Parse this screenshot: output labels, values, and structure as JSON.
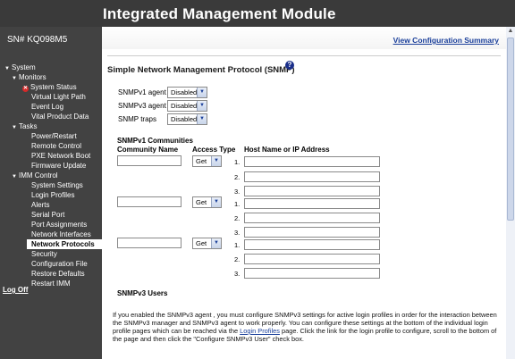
{
  "header": {
    "title": "Integrated Management Module"
  },
  "sidebar": {
    "serial": "SN# KQ098M5",
    "items": [
      {
        "label": "System"
      },
      {
        "label": "Monitors"
      },
      {
        "label": "System Status"
      },
      {
        "label": "Virtual Light Path"
      },
      {
        "label": "Event Log"
      },
      {
        "label": "Vital Product Data"
      },
      {
        "label": "Tasks"
      },
      {
        "label": "Power/Restart"
      },
      {
        "label": "Remote Control"
      },
      {
        "label": "PXE Network Boot"
      },
      {
        "label": "Firmware Update"
      },
      {
        "label": "IMM Control"
      },
      {
        "label": "System Settings"
      },
      {
        "label": "Login Profiles"
      },
      {
        "label": "Alerts"
      },
      {
        "label": "Serial Port"
      },
      {
        "label": "Port Assignments"
      },
      {
        "label": "Network Interfaces"
      },
      {
        "label": "Network Protocols"
      },
      {
        "label": "Security"
      },
      {
        "label": "Configuration File"
      },
      {
        "label": "Restore Defaults"
      },
      {
        "label": "Restart IMM"
      }
    ],
    "logoff": "Log Off"
  },
  "content": {
    "view_config_link": "View Configuration Summary",
    "section_title": "Simple Network Management Protocol (SNMP)",
    "help_icon": "?",
    "agents": [
      {
        "label": "SNMPv1 agent",
        "value": "Disabled"
      },
      {
        "label": "SNMPv3 agent",
        "value": "Disabled"
      },
      {
        "label": "SNMP traps",
        "value": "Disabled"
      }
    ],
    "communities": {
      "title": "SNMPv1 Communities",
      "col_name": "Community Name",
      "col_access": "Access Type",
      "col_host": "Host Name or IP Address",
      "host_numbers": [
        "1.",
        "2.",
        "3."
      ],
      "rows": [
        {
          "name": "",
          "access": "Get",
          "hosts": [
            "",
            "",
            ""
          ]
        },
        {
          "name": "",
          "access": "Get",
          "hosts": [
            "",
            "",
            ""
          ]
        },
        {
          "name": "",
          "access": "Get",
          "hosts": [
            "",
            "",
            ""
          ]
        }
      ]
    },
    "users": {
      "title": "SNMPv3 Users",
      "para_before_link": "If you enabled the SNMPv3 agent , you must configure SNMPv3 settings for active login profiles in order for the interaction between the SNMPv3 manager and SNMPv3 agent to work properly. You can configure these settings at the bottom of the individual login profile pages which can be reached via the ",
      "para_link": "Login Profiles",
      "para_after_link": " page. Click the link for the login profile to configure, scroll to the bottom of the page and then click the \"Configure SNMPv3 User\" check box."
    }
  },
  "colors": {
    "header_bg": "#3a3a3a",
    "sidebar_bg": "#424242",
    "link": "#1a3f9a",
    "warn": "#d42a2a"
  },
  "icons": {
    "expand": "triangle-down-icon",
    "status_warning": "warning-icon",
    "help": "help-icon",
    "dropdown": "chevron-down-icon"
  }
}
